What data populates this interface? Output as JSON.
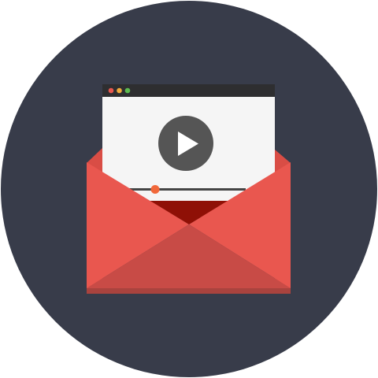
{
  "icon": {
    "name": "video-email-icon",
    "colors": {
      "background_circle": "#383c4a",
      "window_titlebar": "#2e2e30",
      "window_body": "#f5f5f5",
      "traffic_light_red": "#e8574e",
      "traffic_light_yellow": "#f1ab3c",
      "traffic_light_green": "#5dbb4f",
      "play_button": "#555555",
      "play_triangle": "#ffffff",
      "seek_track": "#444444",
      "seek_knob": "#f1683a",
      "envelope_back": "#d94d45",
      "envelope_inner_flap": "#8f1006",
      "envelope_side_flaps": "#e9574f",
      "envelope_bottom_flap": "#c84b46",
      "envelope_bottom_edge": "#a9433e"
    },
    "parts": [
      "video-window",
      "play-icon",
      "seek-bar",
      "envelope"
    ]
  }
}
